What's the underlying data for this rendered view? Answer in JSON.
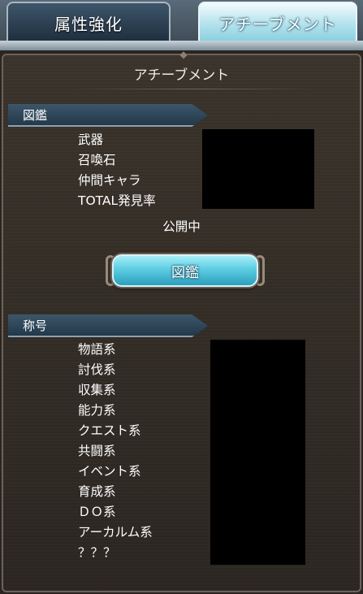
{
  "tabs": [
    {
      "label": "属性強化",
      "active": false
    },
    {
      "label": "アチーブメント",
      "active": true
    }
  ],
  "panel": {
    "title": "アチーブメント"
  },
  "zukan_section": {
    "header": "図鑑",
    "items": [
      "武器",
      "召喚石",
      "仲間キャラ",
      "TOTAL発見率"
    ],
    "status": "公開中",
    "button_label": "図鑑"
  },
  "title_section": {
    "header": "称号",
    "items": [
      "物語系",
      "討伐系",
      "収集系",
      "能力系",
      "クエスト系",
      "共闘系",
      "イベント系",
      "育成系",
      "ＤＯ系",
      "アーカルム系",
      "？？？"
    ]
  },
  "colors": {
    "active_tab": "#9fdbe8",
    "inactive_tab": "#2b3f52",
    "header_bar": "#2e4659",
    "button": "#5ccde2",
    "panel_bg": "#332d27"
  }
}
